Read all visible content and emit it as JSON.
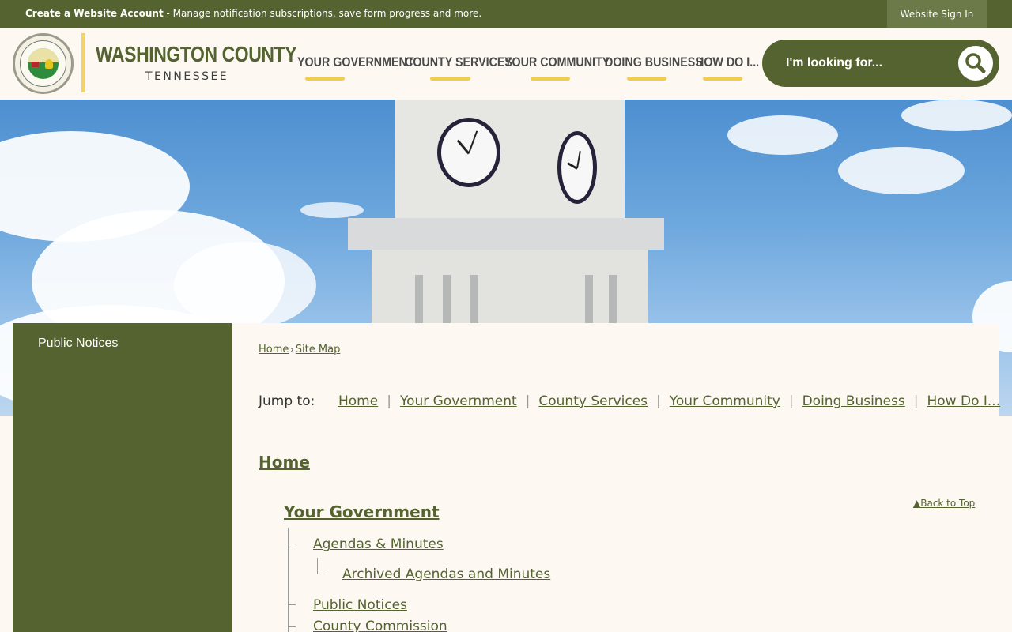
{
  "topbar": {
    "account_link": "Create a Website Account",
    "account_desc": " - Manage notification subscriptions, save form progress and more.",
    "signin_label": "Website Sign In"
  },
  "header": {
    "brand_name": "WASHINGTON COUNTY",
    "brand_sub": "TENNESSEE",
    "nav": [
      {
        "label": "YOUR GOVERNMENT"
      },
      {
        "label": "COUNTY SERVICES"
      },
      {
        "label": "YOUR COMMUNITY"
      },
      {
        "label": "DOING BUSINESS"
      },
      {
        "label": "HOW DO I..."
      }
    ],
    "search_placeholder": "I'm looking for..."
  },
  "sidebar": {
    "items": [
      {
        "label": "Public Notices"
      }
    ]
  },
  "content": {
    "breadcrumb": [
      "Home",
      "Site Map"
    ],
    "jump_label": "Jump to:",
    "jump_links": [
      "Home",
      "Your Government",
      "County Services",
      "Your Community",
      "Doing Business",
      "How Do I..."
    ],
    "home_heading": "Home",
    "section_heading": "Your Government",
    "back_to_top": "Back to Top",
    "tree": [
      {
        "label": "Agendas & Minutes"
      },
      {
        "label": "Archived Agendas and Minutes"
      },
      {
        "label": "Public Notices"
      },
      {
        "label": "County Commission"
      }
    ]
  },
  "colors": {
    "primary_green": "#546330",
    "accent_yellow": "#f1cd4e",
    "background": "#fdf9f2"
  }
}
